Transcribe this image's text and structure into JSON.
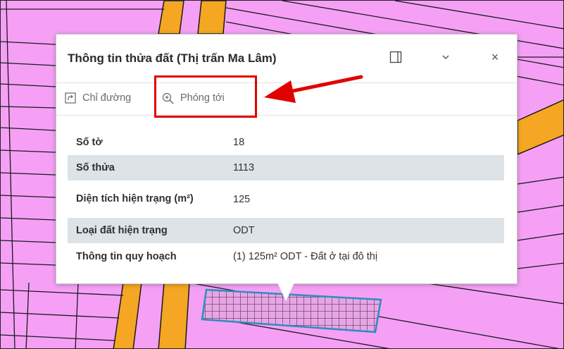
{
  "popup": {
    "title": "Thông tin thửa đất (Thị trấn Ma Lâm)",
    "dock_icon": "dock-panel-icon",
    "collapse_icon": "chevron-down-icon",
    "close_icon": "close-icon",
    "close_glyph": "×"
  },
  "actions": [
    {
      "label": "Chỉ đường",
      "icon": "directions-icon"
    },
    {
      "label": "Phóng tới",
      "icon": "zoom-in-icon"
    }
  ],
  "attributes": [
    {
      "key": "Số tờ",
      "value": "18"
    },
    {
      "key": "Số thửa",
      "value": "1113"
    },
    {
      "key": "Diện tích hiện trạng (m²)",
      "value": "125"
    },
    {
      "key": "Loại đất hiện trạng",
      "value": "ODT"
    },
    {
      "key": "Thông tin quy hoạch",
      "value": "(1) 125m² ODT - Đất ở tại đô thị"
    }
  ],
  "colors": {
    "parcel_fill": "#f5a0f5",
    "road_fill": "#f5a623",
    "parcel_line": "#1a1a1a",
    "selection_outline": "#2a8fbd",
    "selection_hatch": "#6b3a5a",
    "annotation_red": "#e10000",
    "row_alt_bg": "#dde3e6"
  }
}
